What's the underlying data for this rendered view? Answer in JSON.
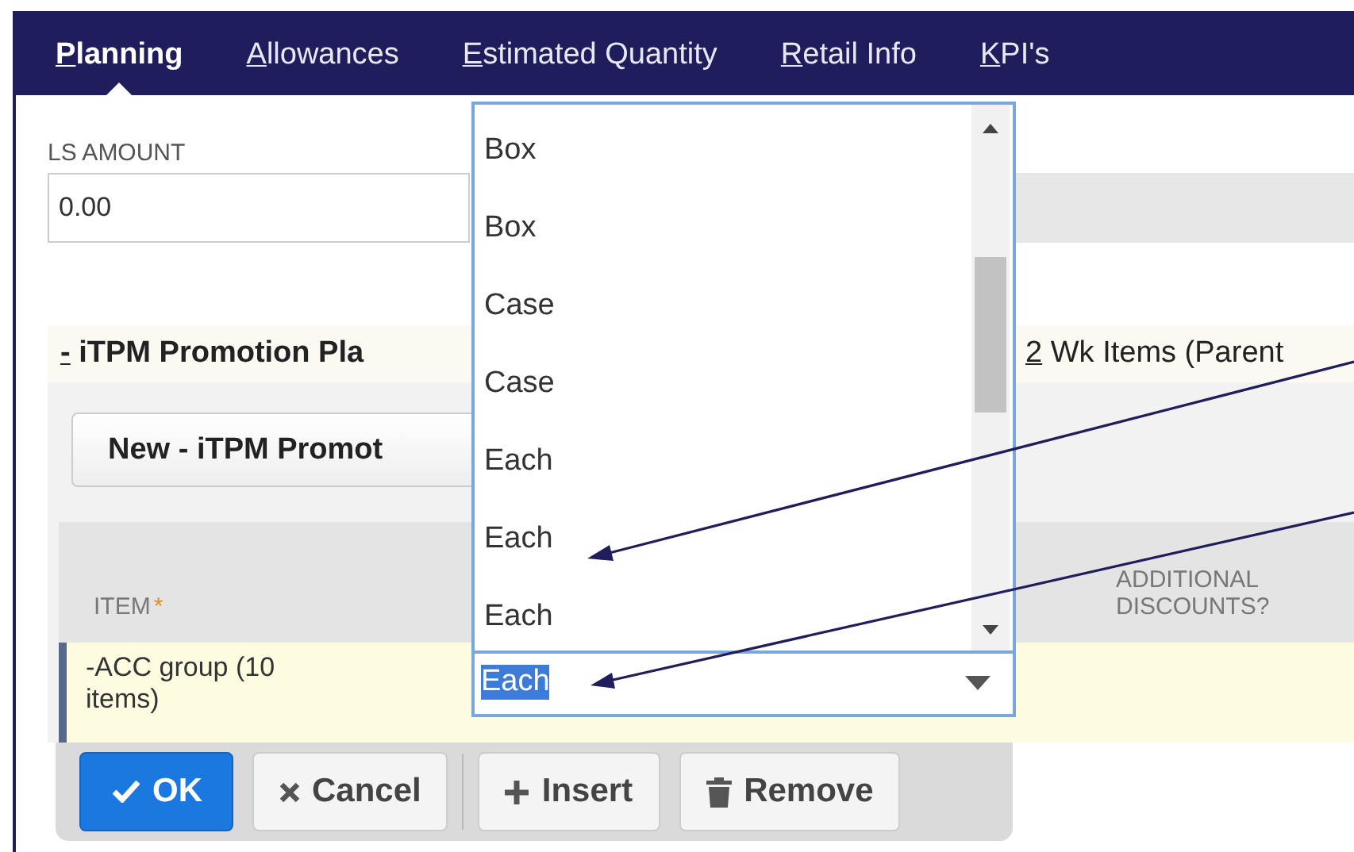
{
  "tabs": [
    {
      "label": "Planning",
      "selected": true
    },
    {
      "label": "Allowances",
      "selected": false
    },
    {
      "label": "Estimated Quantity",
      "selected": false
    },
    {
      "label": "Retail Info",
      "selected": false
    },
    {
      "label": "KPI's",
      "selected": false
    }
  ],
  "ls_amount": {
    "label": "LS AMOUNT",
    "value": "0.00"
  },
  "sublist_tabs": [
    {
      "label": "- iTPM Promotion Pla",
      "selected": true
    },
    {
      "label": "2 Wk Items (Parent",
      "selected": false
    }
  ],
  "new_button": "New - iTPM Promot",
  "table": {
    "columns": [
      {
        "label": "ITEM",
        "mark": "*"
      },
      {
        "label": "ADDITIONAL DISCOUNTS?"
      }
    ],
    "rows": [
      {
        "item": "-ACC group (10 items)",
        "unit": "Each"
      }
    ]
  },
  "unit_dropdown": {
    "options": [
      "Box",
      "Box",
      "Case",
      "Case",
      "Each",
      "Each",
      "Each"
    ]
  },
  "buttons": [
    {
      "label": "OK",
      "kind": "primary"
    },
    {
      "label": "Cancel",
      "kind": "cancel"
    },
    {
      "label": "Insert",
      "kind": "insert"
    },
    {
      "label": "Remove",
      "kind": "remove"
    }
  ]
}
